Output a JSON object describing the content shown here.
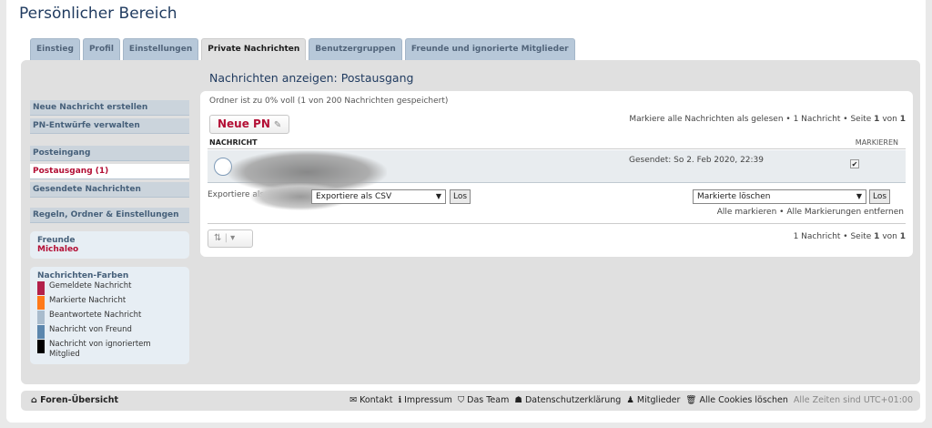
{
  "page": {
    "title": "Persönlicher Bereich"
  },
  "tabs": [
    "Einstieg",
    "Profil",
    "Einstellungen",
    "Private Nachrichten",
    "Benutzergruppen",
    "Freunde und ignorierte Mitglieder"
  ],
  "active_tab": "Private Nachrichten",
  "sidebar": {
    "links": [
      "Neue Nachricht erstellen",
      "PN-Entwürfe verwalten",
      "Posteingang",
      "Postausgang (1)",
      "Gesendete Nachrichten",
      "Regeln, Ordner & Einstellungen"
    ],
    "friends_heading": "Freunde",
    "friend": "Michaleo",
    "colors_heading": "Nachrichten-Farben",
    "legend": [
      {
        "label": "Gemeldete Nachricht",
        "color": "#b3204a"
      },
      {
        "label": "Markierte Nachricht",
        "color": "#ff7a1a"
      },
      {
        "label": "Beantwortete Nachricht",
        "color": "#a9bccd"
      },
      {
        "label": "Nachricht von Freund",
        "color": "#5b86ad"
      },
      {
        "label": "Nachricht von ignoriertem Mitglied",
        "color": "#000000"
      }
    ]
  },
  "main": {
    "heading": "Nachrichten anzeigen: Postausgang",
    "folder_status": "Ordner ist zu 0% voll (1 von 200 Nachrichten gespeichert)",
    "new_pm": "Neue PN",
    "mark_read": "Markiere alle Nachrichten als gelesen",
    "msg_count": "1 Nachricht",
    "page_label": "Seite",
    "page_current": "1",
    "page_of": "von",
    "page_total": "1",
    "col_message": "NACHRICHT",
    "col_mark": "MARKIEREN",
    "sent": "Gesendet: So 2. Feb 2020, 22:39",
    "export_label": "Exportiere als:",
    "export_select": "Exportiere als CSV",
    "go": "Los",
    "action_select": "Markierte löschen",
    "mark_all": "Alle markieren",
    "unmark_all": "Alle Markierungen entfernen"
  },
  "footer": {
    "home": "Foren-Übersicht",
    "links": [
      "Kontakt",
      "Impressum",
      "Das Team",
      "Datenschutzerklärung",
      "Mitglieder",
      "Alle Cookies löschen"
    ],
    "timezone": "Alle Zeiten sind UTC+01:00"
  }
}
